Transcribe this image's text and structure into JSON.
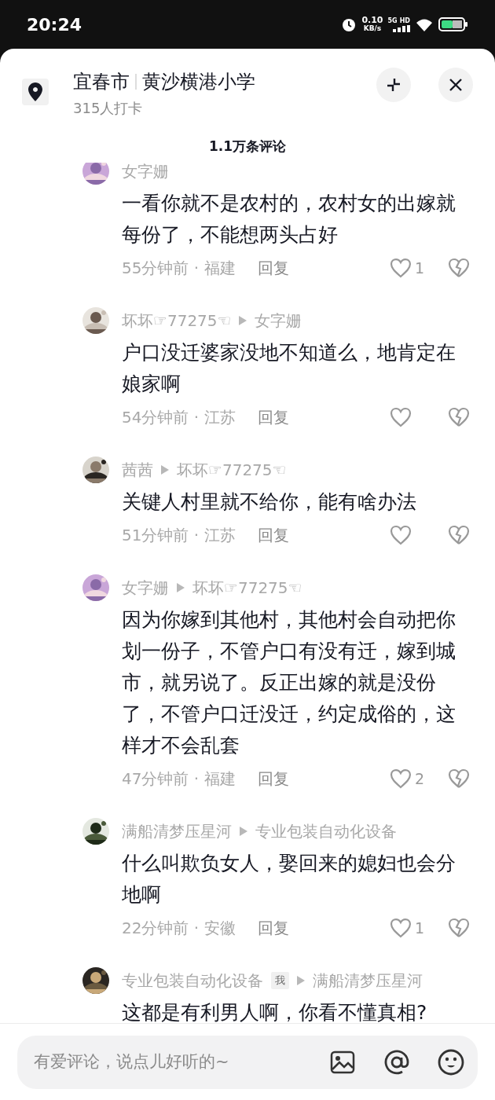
{
  "status_bar": {
    "time": "20:24",
    "net_speed": "0.10",
    "net_unit": "KB/s",
    "network": "5G",
    "network_extra": "HD"
  },
  "header": {
    "city": "宜春市",
    "place": "黄沙横港小学",
    "checkins": "315人打卡"
  },
  "comment_count": "1.1万条评论",
  "comments": [
    {
      "user": "女字姗",
      "text": "一看你就不是农村的，农村女的出嫁就每份了，不能想两头占好",
      "meta": "55分钟前 · 福建",
      "reply_label": "回复",
      "likes": "1"
    },
    {
      "user": "坏坏☞77275☜",
      "reply_to": "女字姗",
      "text": "户口没迁婆家没地不知道么，地肯定在娘家啊",
      "meta": "54分钟前 · 江苏",
      "reply_label": "回复"
    },
    {
      "user": "茜茜",
      "reply_to": "坏坏☞77275☜",
      "text": "关键人村里就不给你，能有啥办法",
      "meta": "51分钟前 · 江苏",
      "reply_label": "回复"
    },
    {
      "user": "女字姗",
      "reply_to": "坏坏☞77275☜",
      "text": "因为你嫁到其他村，其他村会自动把你划一份子，不管户口有没有迁，嫁到城市，就另说了。反正出嫁的就是没份了，不管户口迁没迁，约定成俗的，这样才不会乱套",
      "meta": "47分钟前 · 福建",
      "reply_label": "回复",
      "likes": "2"
    },
    {
      "user": "满船清梦压星河",
      "reply_to": "专业包装自动化设备",
      "text": "什么叫欺负女人，娶回来的媳妇也会分地啊",
      "meta": "22分钟前 · 安徽",
      "reply_label": "回复",
      "likes": "1"
    },
    {
      "user": "专业包装自动化设备",
      "badge": "我",
      "reply_to": "满船清梦压星河",
      "text": "这都是有利男人啊，你看不懂真相?"
    }
  ],
  "input": {
    "placeholder": "有爱评论，说点儿好听的~"
  }
}
